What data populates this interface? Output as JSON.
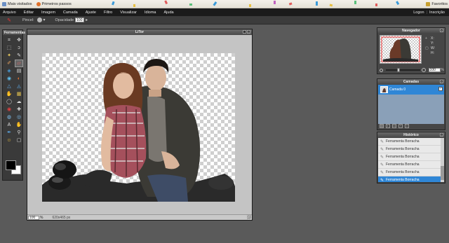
{
  "bookmarks": {
    "items": [
      {
        "label": "Mais visitados",
        "icon": "star-icon"
      },
      {
        "label": "Primeiros passos",
        "icon": "firefox-icon"
      }
    ],
    "right_label": "Favoritos"
  },
  "menubar": {
    "items": [
      "Arquivo",
      "Editar",
      "Imagem",
      "Camada",
      "Ajuste",
      "Filtro",
      "Visualizar",
      "Idioma",
      "Ajuda"
    ],
    "right": {
      "login": "Logon",
      "separator": "|",
      "signup": "Inscrição"
    }
  },
  "options": {
    "tool_icon": "eraser-tool-icon",
    "brush_label": "Pincel:",
    "opacity_label": "Opacidade",
    "opacity_value": "100"
  },
  "tools": {
    "title": "Ferramentas",
    "items": [
      {
        "name": "crop",
        "glyph": "⌗",
        "color": "#ddd"
      },
      {
        "name": "move",
        "glyph": "✥",
        "color": "#ddd"
      },
      {
        "name": "marquee",
        "glyph": "⬚",
        "color": "#ddd"
      },
      {
        "name": "lasso",
        "glyph": "ↄ",
        "color": "#ddd"
      },
      {
        "name": "wand",
        "glyph": "✦",
        "color": "#f0d060"
      },
      {
        "name": "pencil",
        "glyph": "✎",
        "color": "#ddd"
      },
      {
        "name": "brush",
        "glyph": "✐",
        "color": "#e4a060"
      },
      {
        "name": "eraser",
        "glyph": "▱",
        "color": "#e36060"
      },
      {
        "name": "bucket",
        "glyph": "◈",
        "color": "#4aa0e0"
      },
      {
        "name": "gradient",
        "glyph": "▤",
        "color": "#ddd"
      },
      {
        "name": "clone",
        "glyph": "◉",
        "color": "#60c0f0"
      },
      {
        "name": "color-replace",
        "glyph": "◐",
        "color": "#e07030"
      },
      {
        "name": "sharpen",
        "glyph": "△",
        "color": "#60b0f0"
      },
      {
        "name": "blur",
        "glyph": "◬",
        "color": "#60b0f0"
      },
      {
        "name": "smudge",
        "glyph": "✋",
        "color": "#e0a070"
      },
      {
        "name": "sponge",
        "glyph": "▦",
        "color": "#e0c050"
      },
      {
        "name": "dodge",
        "glyph": "◯",
        "color": "#ddd"
      },
      {
        "name": "burn",
        "glyph": "☁",
        "color": "#ddd"
      },
      {
        "name": "red-eye",
        "glyph": "◉",
        "color": "#e04040"
      },
      {
        "name": "spot-heal",
        "glyph": "✚",
        "color": "#ddd"
      },
      {
        "name": "bloat",
        "glyph": "◍",
        "color": "#80c0f0"
      },
      {
        "name": "pinch",
        "glyph": "◎",
        "color": "#80c0f0"
      },
      {
        "name": "text",
        "glyph": "A",
        "color": "#ddd"
      },
      {
        "name": "hand",
        "glyph": "✋",
        "color": "#f0c080"
      },
      {
        "name": "eyedropper",
        "glyph": "✒",
        "color": "#60b0f0"
      },
      {
        "name": "zoom",
        "glyph": "⚲",
        "color": "#ddd"
      },
      {
        "name": "smiley",
        "glyph": "☺",
        "color": "#f0c040"
      },
      {
        "name": "shapes",
        "glyph": "▢",
        "color": "#ddd"
      }
    ],
    "foreground_color": "#000000",
    "background_color": "#ffffff"
  },
  "document": {
    "title": "LiTor",
    "zoom": "100",
    "zoom_suffix": "%",
    "dimensions": "620x465 px"
  },
  "navigator": {
    "title": "Navegador",
    "x_label": "X:",
    "y_label": "Y:",
    "w_label": "W:",
    "h_label": "H:",
    "zoom_value": "100",
    "zoom_suffix": "%",
    "zoom_fraction": 0.33
  },
  "layers": {
    "title": "Camadas",
    "items": [
      {
        "label": "Camada 0",
        "visible": true,
        "selected": true
      }
    ]
  },
  "history": {
    "title": "Histórico",
    "items": [
      {
        "label": "Ferramenta Borracha",
        "active": false
      },
      {
        "label": "Ferramenta Borracha",
        "active": false
      },
      {
        "label": "Ferramenta Borracha",
        "active": false
      },
      {
        "label": "Ferramenta Borracha",
        "active": false
      },
      {
        "label": "Ferramenta Borracha",
        "active": false
      },
      {
        "label": "Ferramenta Borracha",
        "active": true
      }
    ]
  },
  "colors": {
    "accent": "#2f86d6",
    "panel": "#464646",
    "workspace": "#5a5a5a",
    "menubar": "#1b1b1b"
  }
}
